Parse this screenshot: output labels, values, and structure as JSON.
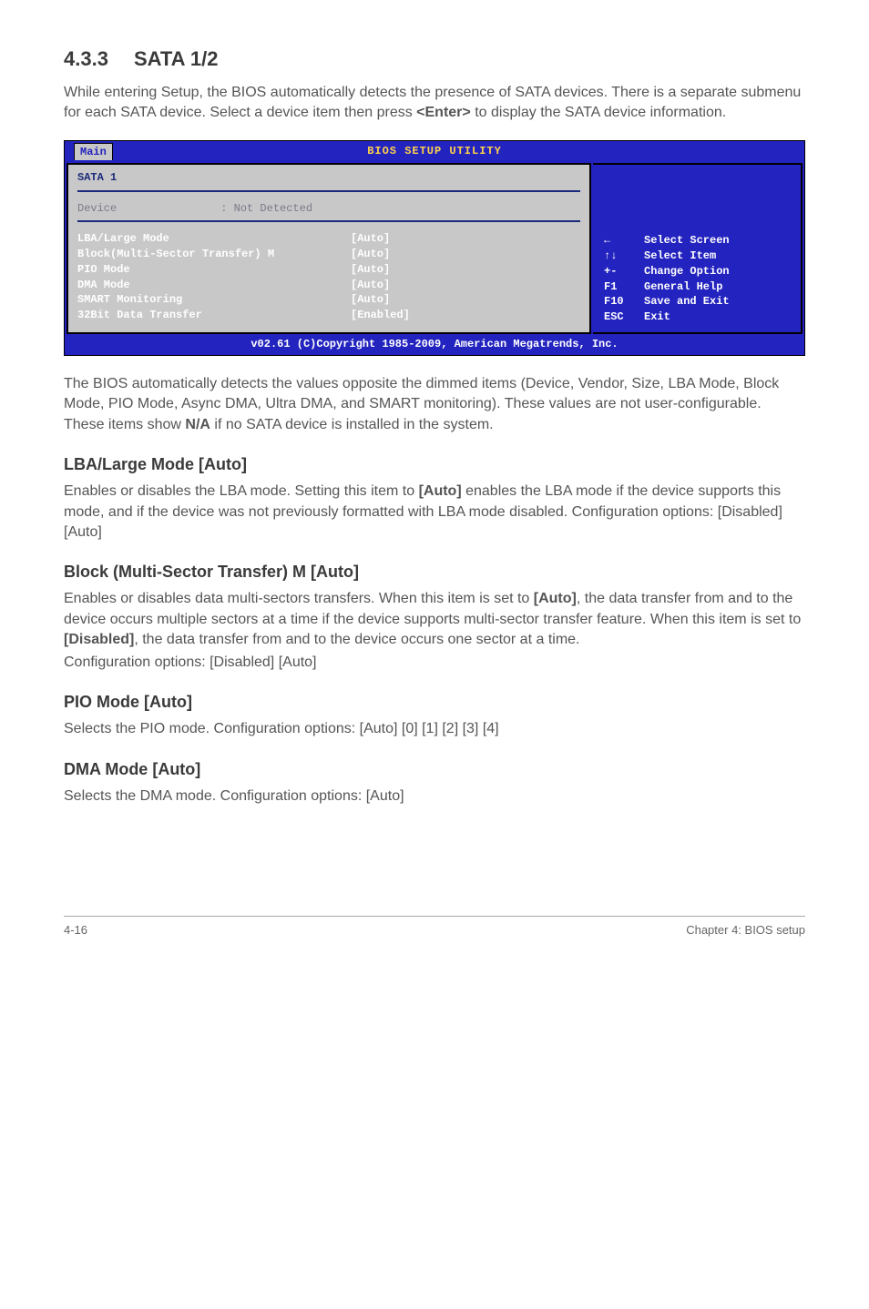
{
  "section": {
    "number": "4.3.3",
    "title": "SATA 1/2"
  },
  "intro": {
    "p1a": "While entering Setup, the BIOS automatically detects the presence of SATA devices. There is a separate submenu for each SATA device. Select a device item then press ",
    "enter": "<Enter>",
    "p1b": " to display the SATA device information."
  },
  "bios": {
    "header_title": "BIOS SETUP UTILITY",
    "tab": "Main",
    "left": {
      "title": "SATA 1",
      "device_label": "Device",
      "device_sep": ":",
      "device_value": "Not Detected",
      "rows": [
        {
          "label": "LBA/Large Mode",
          "value": "[Auto]"
        },
        {
          "label": "Block(Multi-Sector Transfer) M",
          "value": "[Auto]"
        },
        {
          "label": "PIO Mode",
          "value": "[Auto]"
        },
        {
          "label": "DMA Mode",
          "value": "[Auto]"
        },
        {
          "label": "SMART Monitoring",
          "value": "[Auto]"
        },
        {
          "label": "32Bit Data Transfer",
          "value": "[Enabled]"
        }
      ]
    },
    "help": [
      {
        "key": "←",
        "text": "Select Screen"
      },
      {
        "key": "↑↓",
        "text": "Select Item"
      },
      {
        "key": "+-",
        "text": "Change Option"
      },
      {
        "key": "F1",
        "text": "General Help"
      },
      {
        "key": "F10",
        "text": "Save and Exit"
      },
      {
        "key": "ESC",
        "text": "Exit"
      }
    ],
    "footer": "v02.61 (C)Copyright 1985-2009, American Megatrends, Inc."
  },
  "para_after_bios": {
    "a": "The BIOS automatically detects the values opposite the dimmed items (Device, Vendor, Size, LBA Mode, Block Mode, PIO Mode, Async DMA, Ultra DMA, and SMART monitoring). These values are not user-configurable. These items show ",
    "na": "N/A",
    "b": " if no SATA device is installed in the system."
  },
  "subsections": {
    "lba": {
      "heading": "LBA/Large Mode [Auto]",
      "body_a": "Enables or disables the LBA mode. Setting this item to ",
      "auto": "[Auto]",
      "body_b": " enables the LBA mode if the device supports this mode, and if the device was not previously formatted with LBA mode disabled. Configuration options: [Disabled] [Auto]"
    },
    "block": {
      "heading": "Block (Multi-Sector Transfer) M [Auto]",
      "body_a": "Enables or disables data multi-sectors transfers. When this item is set to ",
      "auto": "[Auto]",
      "body_b": ", the data transfer from and to the device occurs multiple sectors at a time if the device supports multi-sector transfer feature. When this item is set to ",
      "disabled": "[Disabled]",
      "body_c": ", the data transfer from and to the device occurs one sector at a time.",
      "body_d": "Configuration options: [Disabled] [Auto]"
    },
    "pio": {
      "heading": "PIO Mode [Auto]",
      "body": "Selects the PIO mode. Configuration options: [Auto] [0] [1] [2] [3] [4]"
    },
    "dma": {
      "heading": "DMA Mode [Auto]",
      "body": "Selects the DMA mode. Configuration options: [Auto]"
    }
  },
  "footer": {
    "left": "4-16",
    "right": "Chapter 4: BIOS setup"
  }
}
